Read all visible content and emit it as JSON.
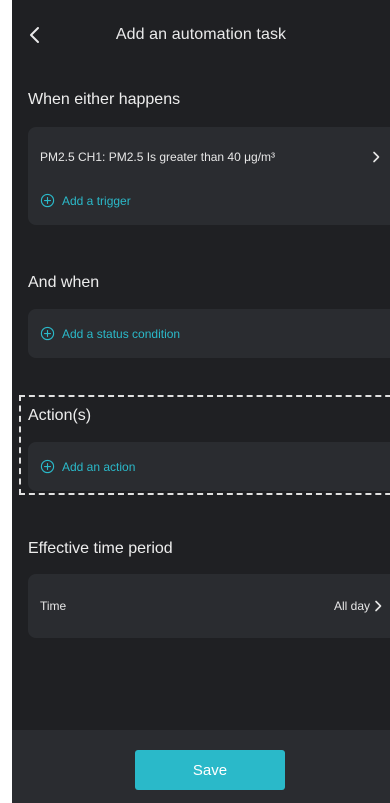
{
  "header": {
    "title": "Add an automation task",
    "back_icon": "chevron-left-icon"
  },
  "triggers": {
    "title": "When either happens",
    "items": [
      {
        "label": "PM2.5 CH1: PM2.5 Is greater than 40 μg/m³"
      }
    ],
    "add_label": "Add a trigger"
  },
  "conditions": {
    "title": "And when",
    "add_label": "Add a status condition"
  },
  "actions": {
    "title": "Action(s)",
    "add_label": "Add an action"
  },
  "time_period": {
    "title": "Effective time period",
    "row_label": "Time",
    "value": "All day"
  },
  "footer": {
    "save_label": "Save"
  },
  "colors": {
    "background": "#1f2023",
    "card": "#2a2c30",
    "accent": "#2ab9c9",
    "text": "#e6e6e6"
  }
}
